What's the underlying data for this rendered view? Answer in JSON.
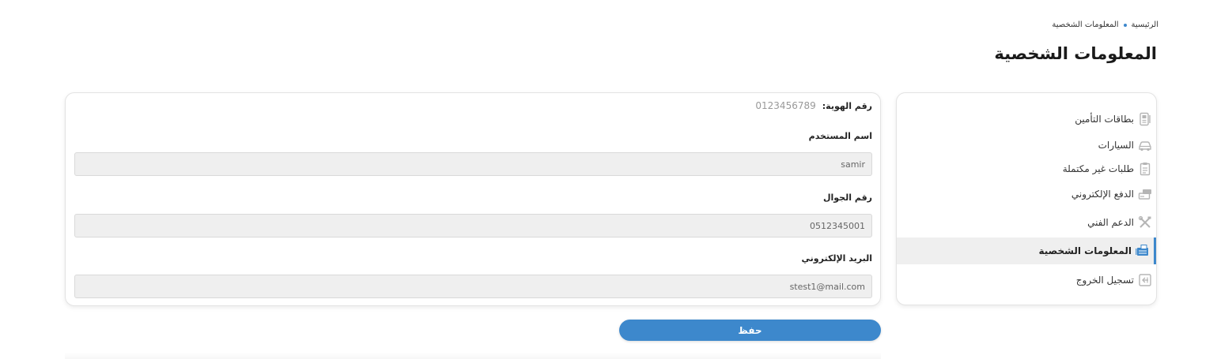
{
  "breadcrumb": {
    "home": "الرئيسية",
    "current": "المعلومات الشخصية"
  },
  "page_title": "المعلومات الشخصية",
  "sidebar": {
    "items": [
      {
        "label": "بطاقات التأمين",
        "icon": "insurance-card-icon"
      },
      {
        "label": "السيارات",
        "icon": "car-icon"
      },
      {
        "label": "طلبات غير مكتملة",
        "icon": "clipboard-icon"
      },
      {
        "label": "الدفع الإلكتروني",
        "icon": "payment-icon"
      },
      {
        "label": "الدعم الفني",
        "icon": "tools-icon"
      },
      {
        "label": "المعلومات الشخصية",
        "icon": "id-card-icon",
        "active": true
      },
      {
        "label": "تسجيل الخروج",
        "icon": "logout-icon"
      }
    ]
  },
  "form": {
    "id_label": "رقم الهوية:",
    "id_value": "0123456789",
    "username_label": "اسم المستخدم",
    "username_value": "samir",
    "phone_label": "رقم الجوال",
    "phone_value": "0512345001",
    "email_label": "البريد الإلكتروني",
    "email_value": "stest1@mail.com",
    "save_label": "حفظ"
  },
  "colors": {
    "accent": "#3d88cc",
    "input_bg": "#efefef",
    "active_item_bg": "#efefef"
  }
}
